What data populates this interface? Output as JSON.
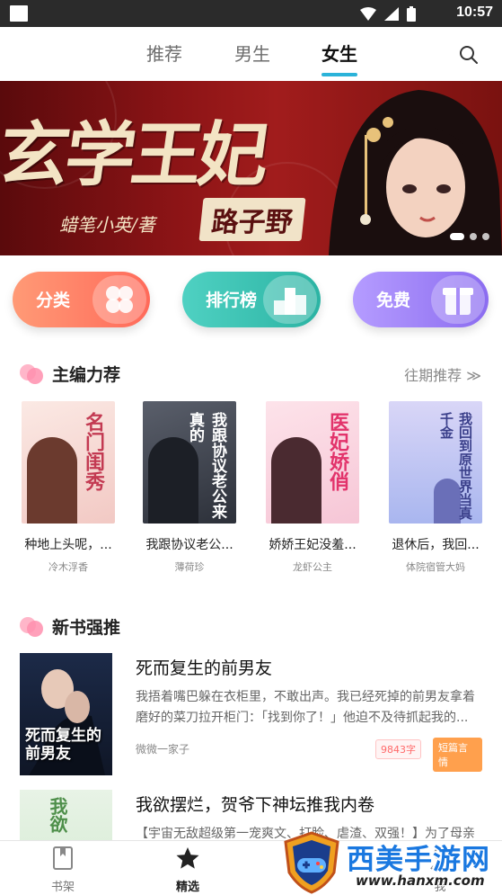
{
  "status_bar": {
    "time": "10:57"
  },
  "top_tabs": [
    {
      "label": "推荐",
      "active": false
    },
    {
      "label": "男生",
      "active": false
    },
    {
      "label": "女生",
      "active": true
    }
  ],
  "banner": {
    "title": "玄学王妃",
    "subtitle": "路子野",
    "author": "蜡笔小英/著",
    "page_count": 3,
    "active_page": 1
  },
  "quick_actions": [
    {
      "label": "分类",
      "icon": "grid-flower-icon"
    },
    {
      "label": "排行榜",
      "icon": "podium-icon"
    },
    {
      "label": "免费",
      "icon": "gift-icon"
    }
  ],
  "editor_picks": {
    "title": "主编力荐",
    "more": "往期推荐 ≫",
    "books": [
      {
        "name": "种地上头呢，...",
        "author": "冷木浮香",
        "cover_text": "名门闺秀"
      },
      {
        "name": "我跟协议老公...",
        "author": "薄荷珍",
        "cover_text": "我跟协议老公来真的"
      },
      {
        "name": "娇娇王妃没羞...",
        "author": "龙虾公主",
        "cover_text": "医妃娇俏"
      },
      {
        "name": "退休后，我回...",
        "author": "体院宿管大妈",
        "cover_text": "我回到原世界当真千金"
      }
    ]
  },
  "new_books": {
    "title": "新书强推",
    "books": [
      {
        "title": "死而复生的前男友",
        "desc": "我捂着嘴巴躲在衣柜里，不敢出声。我已经死掉的前男友拿着磨好的菜刀拉开柜门：「找到你了！」他迫不及待抓起我的...",
        "author": "微微一家子",
        "word_count": "9843字",
        "tag": "短篇言情",
        "cover_text": "死而复生的前男友"
      },
      {
        "title": "我欲摆烂，贺爷下神坛推我内卷",
        "desc": "【宇宙无敌超级第一宠爽文、打脸、虐渣、双强！】为了母亲",
        "cover_text": "我欲"
      }
    ]
  },
  "bottom_nav": [
    {
      "label": "书架",
      "icon": "bookshelf-icon",
      "active": false
    },
    {
      "label": "精选",
      "icon": "star-icon",
      "active": true
    },
    {
      "label": "我",
      "icon": "profile-icon",
      "active": false
    }
  ],
  "watermark": {
    "brand": "西美手游网",
    "url": "www.hanxm.com"
  },
  "colors": {
    "accent": "#2bb3d9",
    "banner_red": "#8c1416",
    "tag_orange": "#ffa04d",
    "word_count_red": "#ff6a6a"
  }
}
